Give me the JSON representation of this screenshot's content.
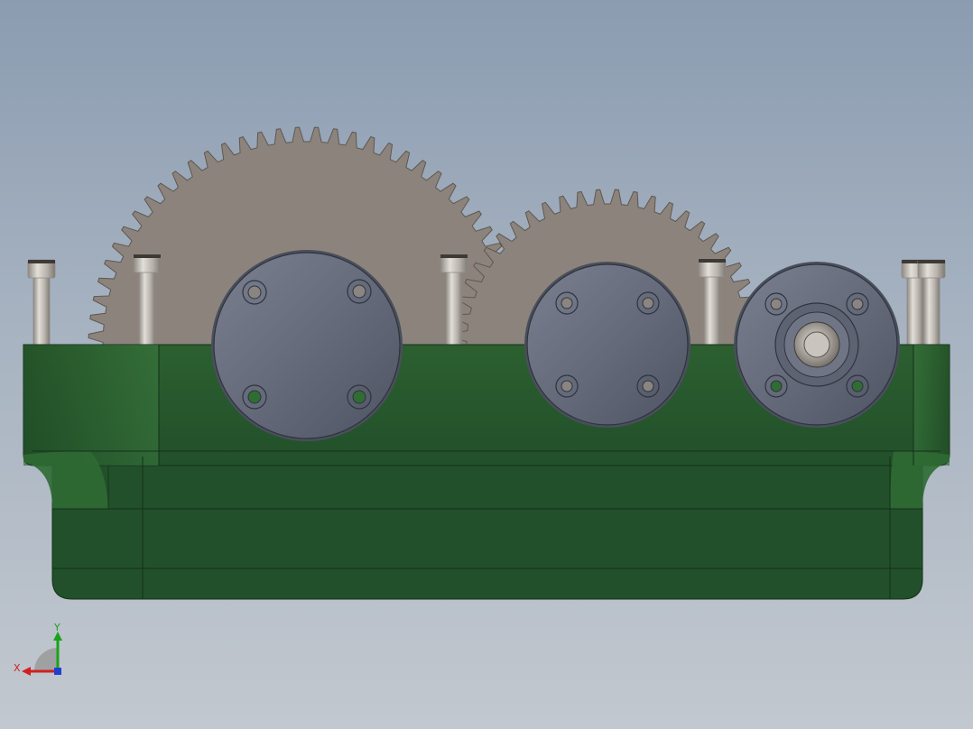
{
  "triad": {
    "x_label": "X",
    "y_label": "Y",
    "colors": {
      "x": "#d11f1f",
      "y": "#1aa31a",
      "z": "#1f3fd1"
    }
  },
  "model": {
    "colors": {
      "housing": "#27582b",
      "housing_dark": "#1d4420",
      "housing_light": "#3c7a40",
      "gear": "#8c847c",
      "gear_edge": "#5e5750",
      "cap": "#656b7b",
      "cap_edge": "#4a4f5c",
      "bolt": "#b9b4ad",
      "bolt_dark": "#8e8983",
      "bolt_light": "#dcd8d2",
      "hole_green": "#2f6d33"
    }
  }
}
